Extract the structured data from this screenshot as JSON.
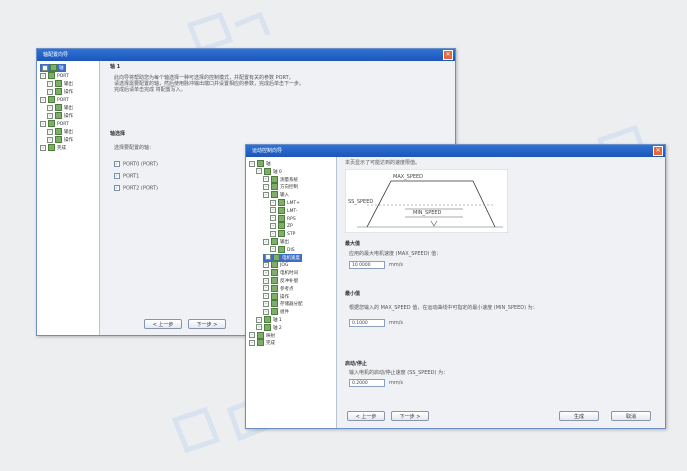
{
  "window_back": {
    "title": "轴配置向导",
    "tree": [
      {
        "label": "轴",
        "level": 0,
        "selected": true
      },
      {
        "label": "PORT",
        "level": 0
      },
      {
        "label": "输出",
        "level": 1
      },
      {
        "label": "操作",
        "level": 1
      },
      {
        "label": "PORT",
        "level": 0
      },
      {
        "label": "输出",
        "level": 1
      },
      {
        "label": "操作",
        "level": 1
      },
      {
        "label": "PORT",
        "level": 0
      },
      {
        "label": "输出",
        "level": 1
      },
      {
        "label": "操作",
        "level": 1
      },
      {
        "label": "完成",
        "level": 0
      }
    ],
    "heading1": "轴 1",
    "desc_line1": "此向导将帮助您为每个轴选择一种可选择的控制模式，并配置有关的参数 PORT。",
    "desc_line2": "请选择需要配置的轴，然后使用脉冲输出端口并设置相应的参数，完成后单击下一步。",
    "desc_line3": "完成后请单击完成 将配置写入。",
    "heading2": "轴选择",
    "prompt": "选择要配置的轴：",
    "checkbox_labels": [
      "PORT0 (PORT)",
      "PORT1",
      "PORT2 (PORT)"
    ],
    "btn_prev": "< 上一步",
    "btn_next": "下一步 >"
  },
  "window_front": {
    "title": "运动控制向导",
    "tree": [
      {
        "label": "轴",
        "level": 0
      },
      {
        "label": "轴 0",
        "level": 1
      },
      {
        "label": "测量系统",
        "level": 2
      },
      {
        "label": "方向控制",
        "level": 2
      },
      {
        "label": "输入",
        "level": 2
      },
      {
        "label": "LMT+",
        "level": 3
      },
      {
        "label": "LMT-",
        "level": 3
      },
      {
        "label": "RPS",
        "level": 3
      },
      {
        "label": "ZP",
        "level": 3
      },
      {
        "label": "STP",
        "level": 3
      },
      {
        "label": "输出",
        "level": 2
      },
      {
        "label": "DIS",
        "level": 3
      },
      {
        "label": "电机速度",
        "level": 2,
        "selected": true
      },
      {
        "label": "JOG",
        "level": 2
      },
      {
        "label": "电机时间",
        "level": 2
      },
      {
        "label": "反冲补偿",
        "level": 2
      },
      {
        "label": "参考点",
        "level": 2
      },
      {
        "label": "操作",
        "level": 2
      },
      {
        "label": "存储器分配",
        "level": 2
      },
      {
        "label": "组件",
        "level": 2
      },
      {
        "label": "轴 1",
        "level": 1
      },
      {
        "label": "轴 2",
        "level": 1
      },
      {
        "label": "映射",
        "level": 0
      },
      {
        "label": "完成",
        "level": 0
      }
    ],
    "intro": "本页显示了可能达到的速度限值。",
    "diagram": {
      "max_speed": "MAX_SPEED",
      "min_speed": "MIN_SPEED",
      "ss_speed": "SS_SPEED"
    },
    "section1_title": "最大值",
    "section1_text": "应用的最大电机速度 (MAX_SPEED) 值：",
    "section1_value": "10 0000",
    "section1_unit": "mm/s",
    "section2_title": "最小值",
    "section2_text": "根据您输入的 MAX_SPEED 值，在运动曲线中可指定的最小速度 (MIN_SPEED) 为：",
    "section2_value": "0.1000",
    "section2_unit": "mm/s",
    "section3_title": "启动/停止",
    "section3_text": "输入电机的启动/停止速度 (SS_SPEED) 为：",
    "section3_value": "0.2000",
    "section3_unit": "mm/s",
    "btn_prev": "< 上一步",
    "btn_next": "下一步 >",
    "btn_finish": "生成",
    "btn_cancel": "取消"
  }
}
